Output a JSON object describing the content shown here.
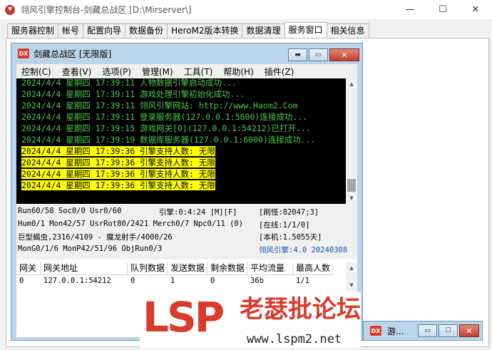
{
  "window": {
    "title": "翎风引擎控制台-剑藏总战区 [D:\\Mirserver\\]",
    "minimize": "—",
    "maximize": "☐",
    "close": "✕"
  },
  "tabs": [
    "服务器控制",
    "帐号",
    "配置向导",
    "数据备份",
    "HeroM2版本转换",
    "数据清理",
    "服务窗口",
    "相关信息"
  ],
  "child": {
    "icon_text": "DX",
    "title": "剑藏总战区 [无限版]",
    "menu": [
      "控制(C)",
      "查看(V)",
      "选项(P)",
      "管理(M)",
      "工具(T)",
      "帮助(H)",
      "插件(Z)"
    ],
    "log": [
      {
        "text": "2024/4/4 星期四 17:39:11 人物数据引擎启动成功...",
        "hl": false
      },
      {
        "text": "2024/4/4 星期四 17:39:11 游戏处理引擎初始化成功...",
        "hl": false
      },
      {
        "text": "2024/4/4 星期四 17:39:11 翎风引擎网站: http://www.Haom2.Com",
        "hl": false
      },
      {
        "text": "2024/4/4 星期四 17:39:11 登录服务器(127.0.0.1:5600)连接成功...",
        "hl": false
      },
      {
        "text": "2024/4/4 星期四 17:39:15 游戏网关[0](127.0.0.1:54212)已打开...",
        "hl": false
      },
      {
        "text": "2024/4/4 星期四 17:39:19 数据库服务器(127.0.0.1:6000)连接成功...",
        "hl": false
      },
      {
        "text": "2024/4/4 星期四 17:39:36 引擎支持人数: 无限",
        "hl": true
      },
      {
        "text": "2024/4/4 星期四 17:39:36 引擎支持人数: 无限",
        "hl": true
      },
      {
        "text": "2024/4/4 星期四 17:39:36 引擎支持人数: 无限",
        "hl": true
      },
      {
        "text": "2024/4/4 星期四 17:39:36 引擎支持人数: 无限",
        "hl": true
      }
    ],
    "status": {
      "run": "Run60/58 Soc0/0 Usr0/60",
      "engine": "引擎:0:4:24 [M][F]",
      "monster": "[刷怪:82047;3]",
      "hum": "Hum0/1 Mon42/57 UsrRot80/2421 Merch0/7 Npc0/11 (0)",
      "online": "[在线:1/1/0]",
      "boss": "巨型蝎虫,2316/4109 - 魔龙射手/4000/26",
      "local": "[本机:1.5055天]",
      "mongo": "MonG0/1/6 MonP42/51/96 ObjRun0/3",
      "version": "翎风引擎:4.0 20240308"
    },
    "grid": {
      "headers": [
        "网关",
        "网关地址",
        "队列数据",
        "发送数据",
        "剩余数据",
        "平均流量",
        "最高人数"
      ],
      "rows": [
        [
          "0",
          "127.0.0.1:54212",
          "0",
          "1",
          "0",
          "36b",
          "1/1"
        ]
      ]
    }
  },
  "minimized": {
    "title": "游..."
  },
  "watermark": {
    "logo": "LSP",
    "name": "老瑟批论坛",
    "url": "www.lspm2.net"
  },
  "colors": {
    "log_green": "#4ec94e",
    "highlight": "#ffff00",
    "brand_red": "#d83c2c"
  }
}
